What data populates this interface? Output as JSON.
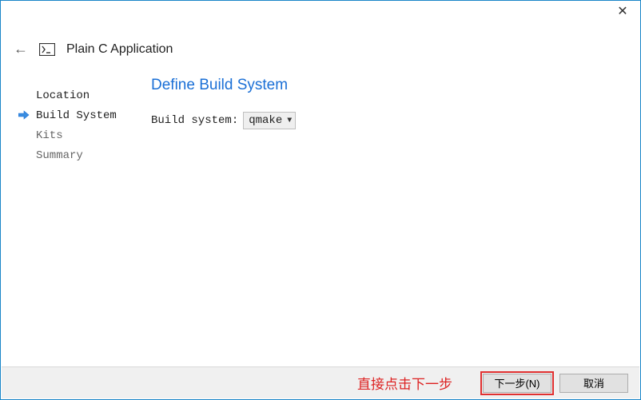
{
  "header": {
    "title": "Plain C Application"
  },
  "sidebar": {
    "steps": [
      {
        "label": "Location",
        "state": "done"
      },
      {
        "label": "Build System",
        "state": "current"
      },
      {
        "label": "Kits",
        "state": "pending"
      },
      {
        "label": "Summary",
        "state": "pending"
      }
    ]
  },
  "main": {
    "title": "Define Build System",
    "build_system_label": "Build system:",
    "build_system_value": "qmake"
  },
  "footer": {
    "annotation": "直接点击下一步",
    "next_label": "下一步(N)",
    "cancel_label": "取消"
  }
}
